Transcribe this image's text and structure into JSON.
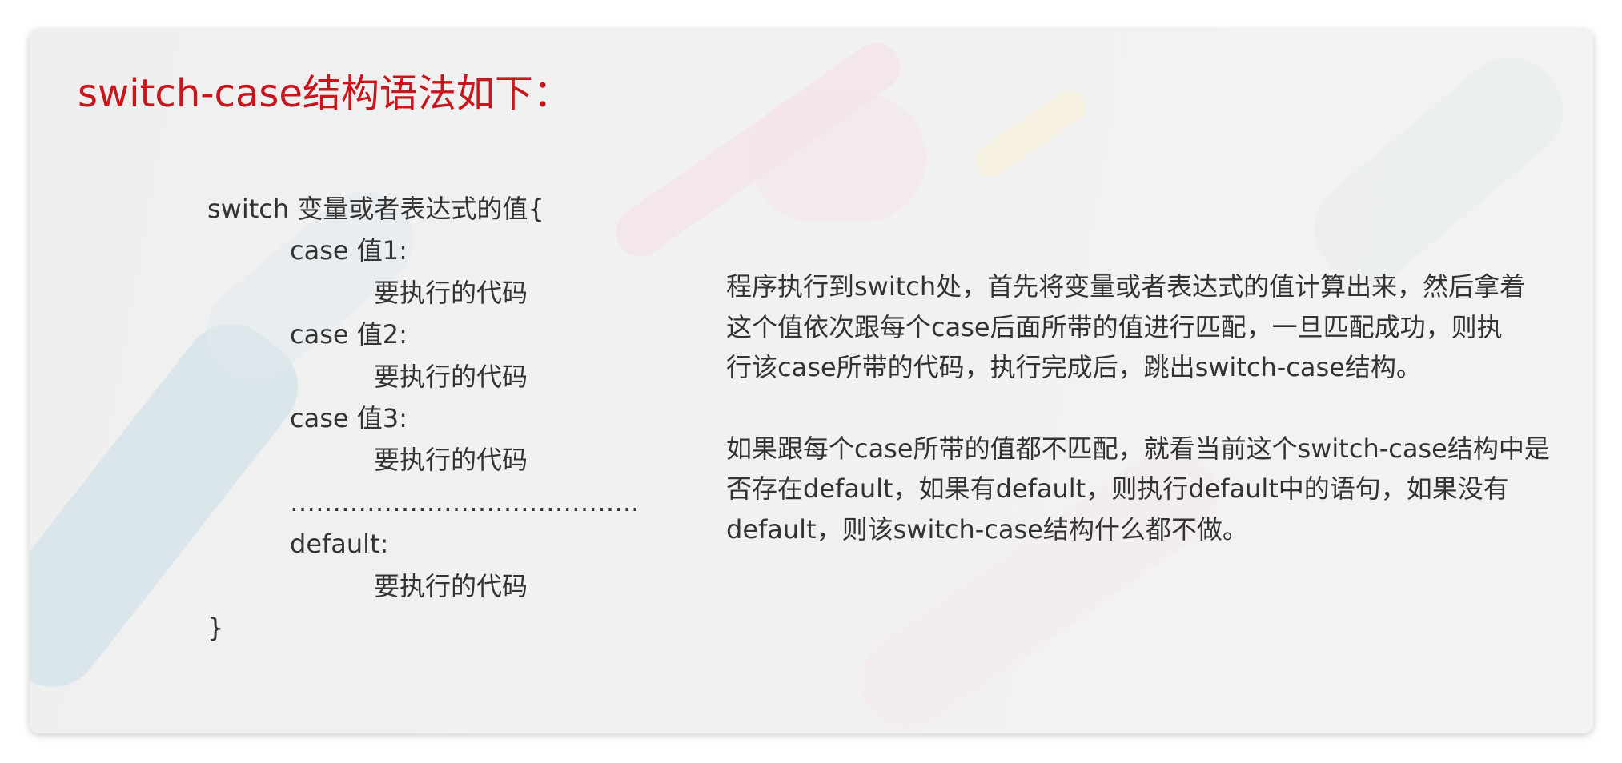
{
  "slide": {
    "title": "switch-case结构语法如下：",
    "code_lines": [
      {
        "text": "switch 变量或者表达式的值{",
        "indent": 0
      },
      {
        "text": "case 值1:",
        "indent": 1
      },
      {
        "text": "要执行的代码",
        "indent": 2
      },
      {
        "text": "case 值2:",
        "indent": 1
      },
      {
        "text": "要执行的代码",
        "indent": 2
      },
      {
        "text": "case 值3:",
        "indent": 1
      },
      {
        "text": "要执行的代码",
        "indent": 2
      },
      {
        "text": "…………………………………..",
        "indent": 1
      },
      {
        "text": "default:",
        "indent": 1
      },
      {
        "text": "要执行的代码",
        "indent": 2
      },
      {
        "text": "}",
        "indent": 0
      }
    ],
    "paragraphs": [
      "程序执行到switch处，首先将变量或者表达式的值计算出来，然后拿着这个值依次跟每个case后面所带的值进行匹配，一旦匹配成功，则执行该case所带的代码，执行完成后，跳出switch-case结构。",
      "如果跟每个case所带的值都不匹配，就看当前这个switch-case结构中是否存在default，如果有default，则执行default中的语句，如果没有default，则该switch-case结构什么都不做。"
    ],
    "colors": {
      "title": "#c8161d",
      "text": "#333333"
    }
  }
}
